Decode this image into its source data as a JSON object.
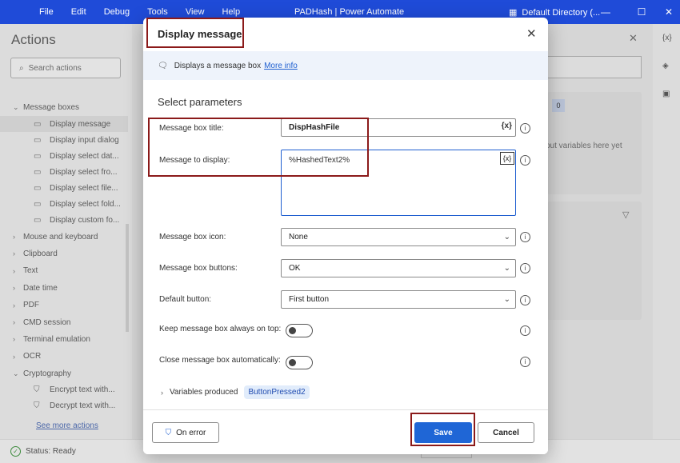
{
  "titlebar": {
    "menu": [
      "File",
      "Edit",
      "Debug",
      "Tools",
      "View",
      "Help"
    ],
    "app_title": "PADHash | Power Automate",
    "directory": "Default Directory (...",
    "minimize_glyph": "—",
    "maximize_glyph": "☐",
    "close_glyph": "✕"
  },
  "actions_panel": {
    "title": "Actions",
    "search_placeholder": "Search actions",
    "see_more": "See more actions",
    "tree": [
      {
        "kind": "cat",
        "label": "Message boxes",
        "expanded": true
      },
      {
        "kind": "sub",
        "label": "Display message",
        "selected": true
      },
      {
        "kind": "sub",
        "label": "Display input dialog"
      },
      {
        "kind": "sub",
        "label": "Display select dat..."
      },
      {
        "kind": "sub",
        "label": "Display select fro..."
      },
      {
        "kind": "sub",
        "label": "Display select file..."
      },
      {
        "kind": "sub",
        "label": "Display select fold..."
      },
      {
        "kind": "sub",
        "label": "Display custom fo..."
      },
      {
        "kind": "cat",
        "label": "Mouse and keyboard"
      },
      {
        "kind": "cat",
        "label": "Clipboard"
      },
      {
        "kind": "cat",
        "label": "Text"
      },
      {
        "kind": "cat",
        "label": "Date time"
      },
      {
        "kind": "cat",
        "label": "PDF"
      },
      {
        "kind": "cat",
        "label": "CMD session"
      },
      {
        "kind": "cat",
        "label": "Terminal emulation"
      },
      {
        "kind": "cat",
        "label": "OCR"
      },
      {
        "kind": "cat",
        "label": "Cryptography",
        "expanded": true
      },
      {
        "kind": "sub",
        "label": "Encrypt text with...",
        "icon": "lock"
      },
      {
        "kind": "sub",
        "label": "Decrypt text with...",
        "icon": "lock"
      }
    ]
  },
  "variables_panel": {
    "count": "0",
    "hint": "put variables here yet"
  },
  "rightbar": {
    "vars_glyph": "{x}"
  },
  "status": {
    "text": "Status: Ready"
  },
  "dialog": {
    "title": "Display message",
    "description": "Displays a message box",
    "more_info": "More info",
    "section_title": "Select parameters",
    "var_glyph": "{x}",
    "params": {
      "title_label": "Message box title:",
      "title_value": "DispHashFile",
      "message_label": "Message to display:",
      "message_value": "%HashedText2%",
      "icon_label": "Message box icon:",
      "icon_value": "None",
      "buttons_label": "Message box buttons:",
      "buttons_value": "OK",
      "default_label": "Default button:",
      "default_value": "First button",
      "keep_on_top_label": "Keep message box always on top:",
      "keep_on_top": false,
      "auto_close_label": "Close message box automatically:",
      "auto_close": false
    },
    "variables_produced_label": "Variables produced",
    "variables_produced": [
      "ButtonPressed2"
    ],
    "on_error": "On error",
    "save": "Save",
    "cancel": "Cancel"
  },
  "colors": {
    "titlebar": "#1f4bd8",
    "primary_button": "#1f66d6",
    "annotation_red": "#8b1a1a"
  }
}
